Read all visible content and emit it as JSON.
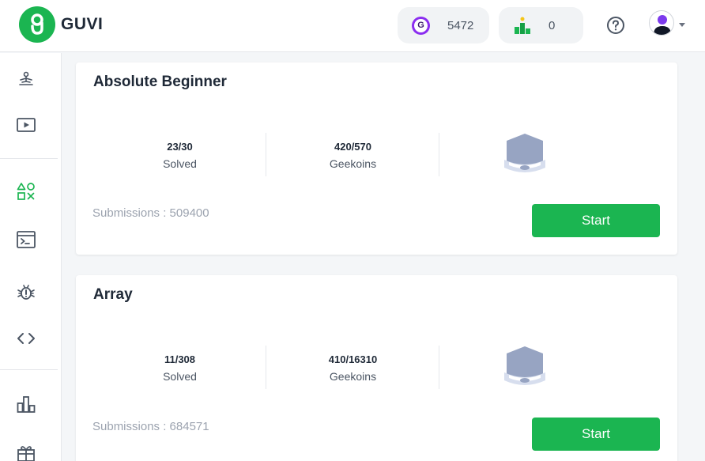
{
  "brand": {
    "name": "GUVI",
    "color": "#1bb551"
  },
  "header": {
    "geekoins": "5472",
    "geekoins_letter": "G",
    "rank": "0"
  },
  "sidebar": {
    "items": [
      {
        "icon": "person-meditate-icon"
      },
      {
        "icon": "video-play-icon"
      },
      {
        "icon": "shapes-icon",
        "active": true
      },
      {
        "icon": "terminal-icon"
      },
      {
        "icon": "bug-icon"
      },
      {
        "icon": "code-brackets-icon"
      },
      {
        "icon": "leaderboard-icon"
      },
      {
        "icon": "gift-icon"
      }
    ]
  },
  "cards": [
    {
      "title": "Absolute Beginner",
      "solved_value": "23/30",
      "solved_label": "Solved",
      "geekoins_value": "420/570",
      "geekoins_label": "Geekoins",
      "submissions": "Submissions : 509400",
      "button": "Start"
    },
    {
      "title": "Array",
      "solved_value": "11/308",
      "solved_label": "Solved",
      "geekoins_value": "410/16310",
      "geekoins_label": "Geekoins",
      "submissions": "Submissions : 684571",
      "button": "Start"
    }
  ]
}
